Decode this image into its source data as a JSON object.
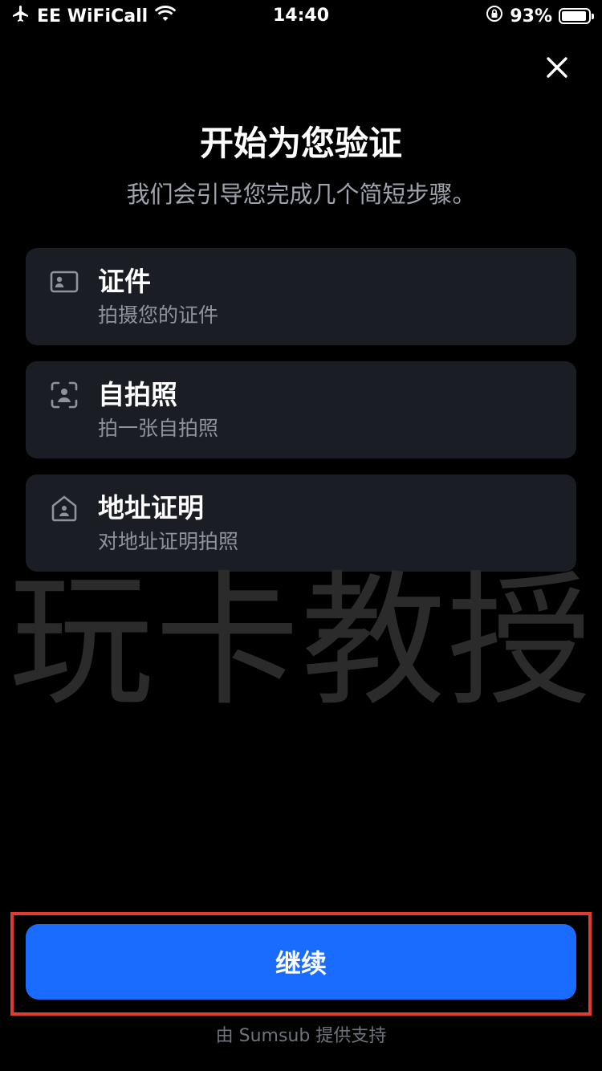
{
  "status_bar": {
    "carrier": "EE WiFiCall",
    "time": "14:40",
    "battery_percent": "93%",
    "battery_level": 0.93,
    "icons": [
      "airplane-icon",
      "wifi-icon",
      "rotation-lock-icon",
      "battery-icon"
    ]
  },
  "header": {
    "close_icon": "close-icon",
    "title": "开始为您验证",
    "subtitle": "我们会引导您完成几个简短步骤。"
  },
  "steps": [
    {
      "icon": "id-card-icon",
      "title": "证件",
      "subtitle": "拍摄您的证件"
    },
    {
      "icon": "selfie-frame-icon",
      "title": "自拍照",
      "subtitle": "拍一张自拍照"
    },
    {
      "icon": "home-icon",
      "title": "地址证明",
      "subtitle": "对地址证明拍照"
    }
  ],
  "watermark": "玩卡教授",
  "footer": {
    "continue_label": "继续",
    "powered_by": "由 Sumsub 提供支持"
  },
  "colors": {
    "background": "#000000",
    "card": "#1b1d24",
    "primary_button": "#1a6bff",
    "highlight_border": "#e23b2f",
    "subtitle_text": "#9ea3ae"
  }
}
